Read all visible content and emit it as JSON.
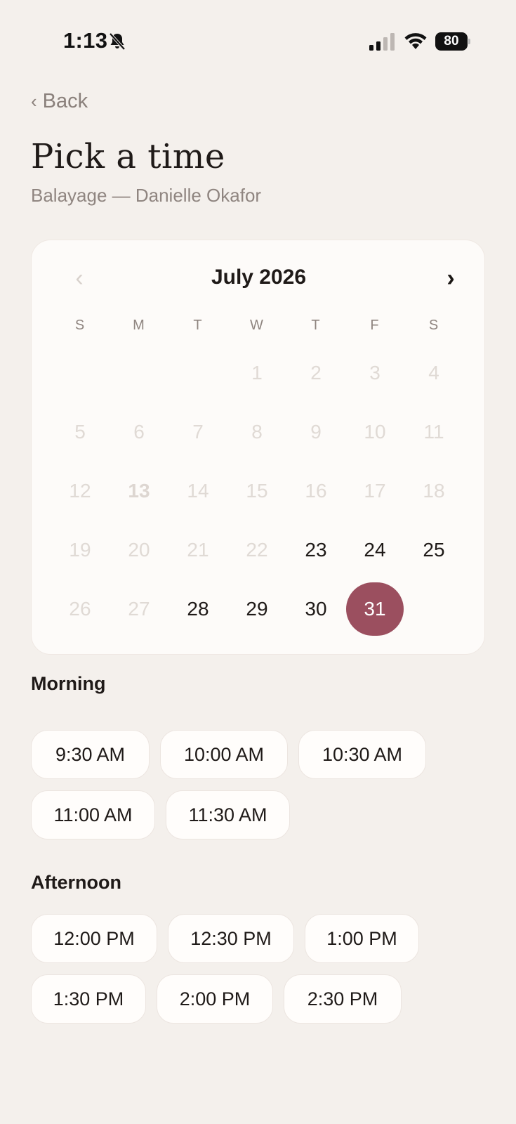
{
  "status_bar": {
    "time": "1:13",
    "battery": "80",
    "icons": [
      "bell-slash-icon",
      "cellular-signal-icon",
      "wifi-icon",
      "battery-icon"
    ]
  },
  "header": {
    "back_label": "Back",
    "title": "Pick a time",
    "subtitle": "Balayage — Danielle Okafor"
  },
  "calendar": {
    "month_label": "July 2026",
    "weekdays": [
      "S",
      "M",
      "T",
      "W",
      "T",
      "F",
      "S"
    ],
    "days": [
      "1",
      "2",
      "3",
      "4",
      "5",
      "6",
      "7",
      "8",
      "9",
      "10",
      "11",
      "12",
      "13",
      "14",
      "15",
      "16",
      "17",
      "18",
      "19",
      "20",
      "21",
      "22",
      "23",
      "24",
      "25",
      "26",
      "27",
      "28",
      "29",
      "30",
      "31"
    ],
    "today": "13",
    "selected": "31",
    "available_days": [
      "23",
      "24",
      "25",
      "28",
      "29",
      "30",
      "31"
    ],
    "selected_color": "#9b4f5f"
  },
  "morning": {
    "title": "Morning",
    "slots": [
      "9:30 AM",
      "10:00 AM",
      "10:30 AM",
      "11:00 AM",
      "11:30 AM"
    ]
  },
  "afternoon": {
    "title": "Afternoon",
    "slots": [
      "12:00 PM",
      "12:30 PM",
      "1:00 PM",
      "1:30 PM",
      "2:00 PM",
      "2:30 PM"
    ]
  }
}
